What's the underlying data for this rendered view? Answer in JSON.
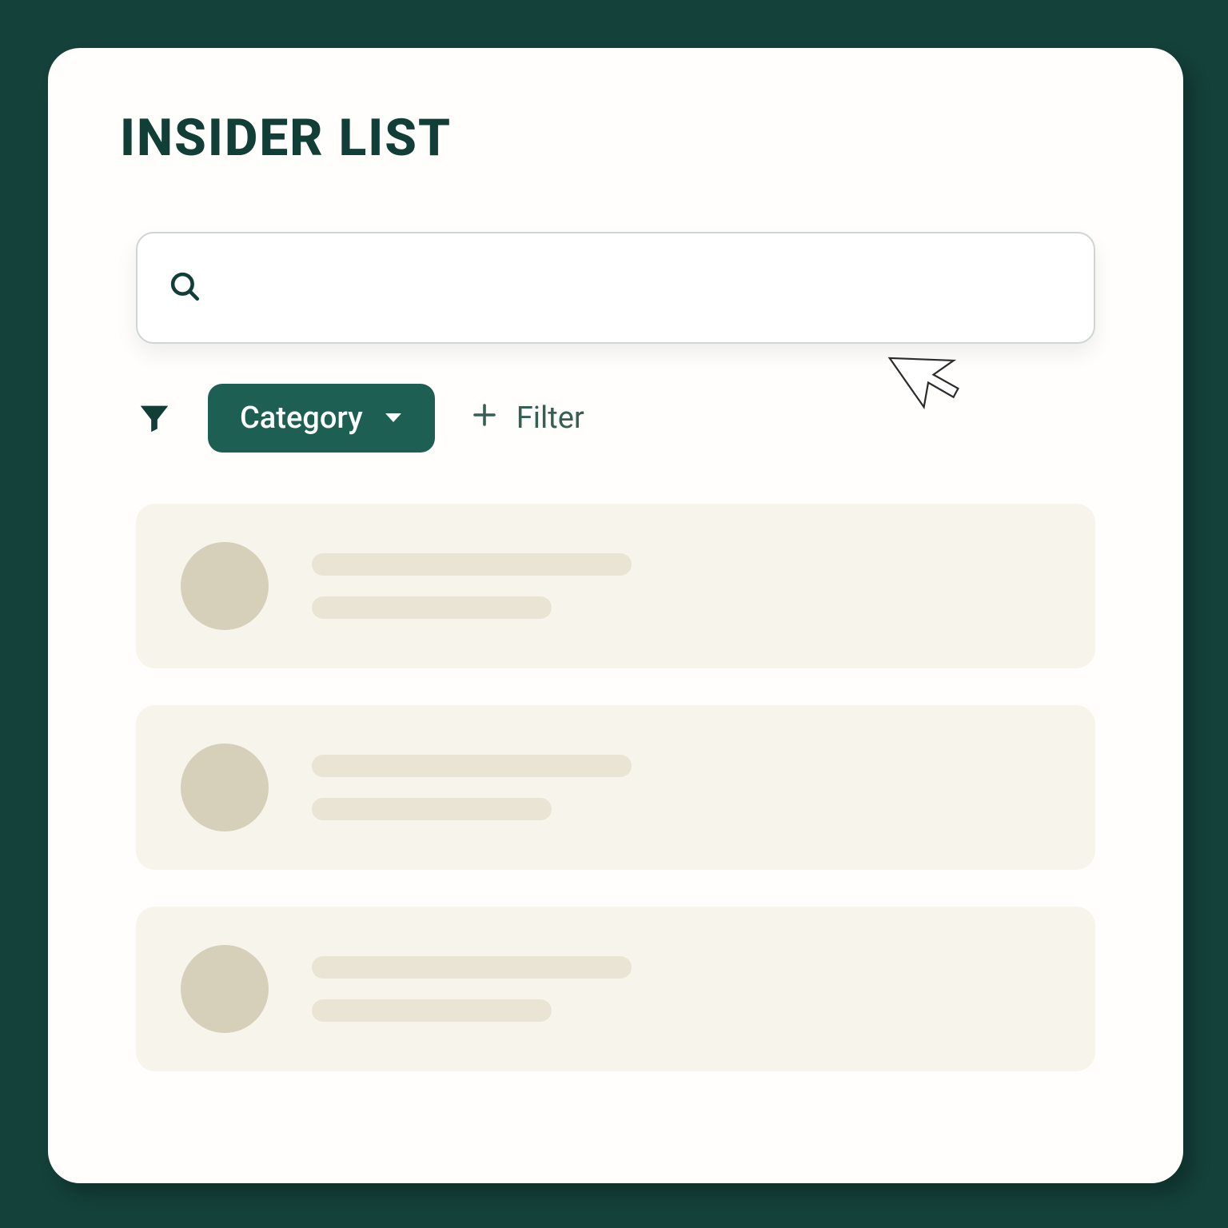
{
  "header": {
    "title": "INSIDER LIST"
  },
  "search": {
    "value": "",
    "placeholder": ""
  },
  "filters": {
    "category_chip_label": "Category",
    "add_filter_label": "Filter"
  },
  "icons": {
    "search": "search-icon",
    "funnel": "funnel-icon",
    "chevron_down": "chevron-down-icon",
    "plus": "plus-icon",
    "cursor": "cursor-arrow-icon"
  },
  "colors": {
    "brand_dark": "#113e36",
    "chip_bg": "#1d5f53",
    "card_bg": "#fffefc",
    "row_bg": "#f7f4ec",
    "skeleton": "#eae4d4",
    "avatar": "#d6cfba"
  },
  "list": {
    "rows": [
      {
        "avatar": true,
        "lines": [
          "long",
          "short"
        ]
      },
      {
        "avatar": true,
        "lines": [
          "long",
          "short"
        ]
      },
      {
        "avatar": true,
        "lines": [
          "long",
          "short"
        ]
      }
    ]
  }
}
